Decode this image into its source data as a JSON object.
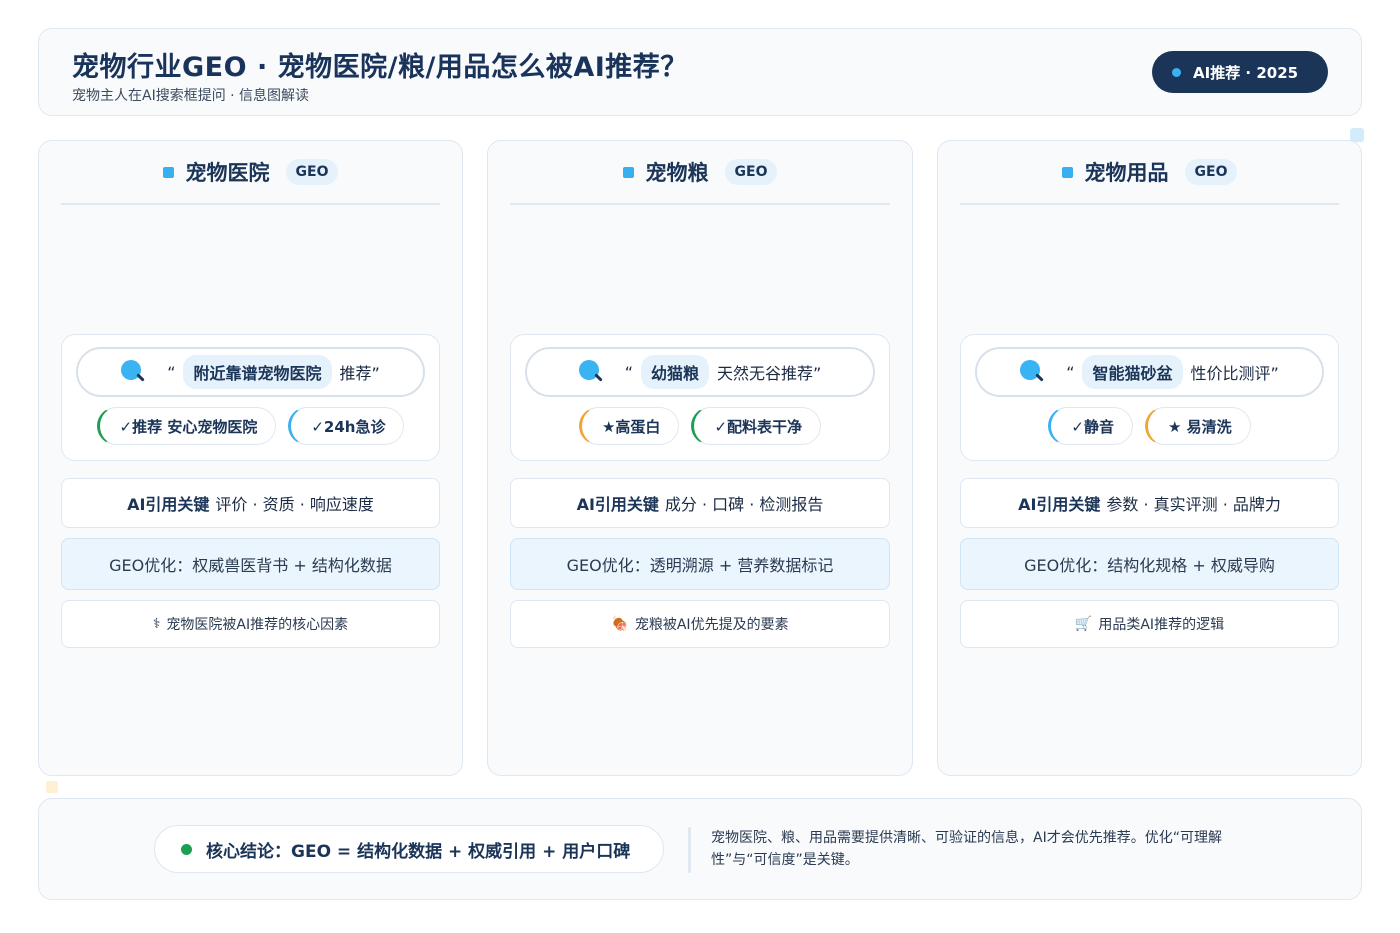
{
  "header": {
    "title": "宠物行业GEO · 宠物医院/粮/用品怎么被AI推荐？",
    "subtitle": "宠物主人在AI搜索框提问 · 信息图解读",
    "badge": "AI推荐 · 2025"
  },
  "columns": [
    {
      "title": "宠物医院",
      "pill": "GEO",
      "search": {
        "open_quote": "“",
        "keyword": "附近靠谱宠物医院",
        "rest": "推荐”"
      },
      "tags": [
        {
          "label": "✓推荐 安心宠物医院",
          "accent": "green"
        },
        {
          "label": "✓24h急诊",
          "accent": "blue"
        }
      ],
      "key_label": "AI引用关键",
      "key_items": "评价 · 资质 · 响应速度",
      "optimization": "GEO优化：权威兽医背书 + 结构化数据",
      "footer_icon": "⚕",
      "footer_icon_name": "caduceus-icon",
      "footer": "宠物医院被AI推荐的核心因素"
    },
    {
      "title": "宠物粮",
      "pill": "GEO",
      "search": {
        "open_quote": "“",
        "keyword": "幼猫粮",
        "rest": "天然无谷推荐”"
      },
      "tags": [
        {
          "label": "★高蛋白",
          "accent": "orange"
        },
        {
          "label": "✓配料表干净",
          "accent": "green"
        }
      ],
      "key_label": "AI引用关键",
      "key_items": "成分 · 口碑 · 检测报告",
      "optimization": "GEO优化：透明溯源 + 营养数据标记",
      "footer_icon": "🍖",
      "footer_icon_name": "meat-icon",
      "footer": "宠粮被AI优先提及的要素"
    },
    {
      "title": "宠物用品",
      "pill": "GEO",
      "search": {
        "open_quote": "“",
        "keyword": "智能猫砂盆",
        "rest": "性价比测评”"
      },
      "tags": [
        {
          "label": "✓静音",
          "accent": "blue"
        },
        {
          "label": "★ 易清洗",
          "accent": "orange"
        }
      ],
      "key_label": "AI引用关键",
      "key_items": "参数 · 真实评测 · 品牌力",
      "optimization": "GEO优化：结构化规格 + 权威导购",
      "footer_icon": "🛒",
      "footer_icon_name": "shopping-cart-icon",
      "footer": "用品类AI推荐的逻辑"
    }
  ],
  "conclusion": {
    "headline": "核心结论：GEO = 结构化数据 + 权威引用 + 用户口碑",
    "description": "宠物医院、粮、用品需要提供清晰、可验证的信息，AI才会优先推荐。优化“可理解性”与“可信度”是关键。"
  },
  "colors": {
    "navy": "#1b3558",
    "accent_blue": "#39b3f2",
    "green": "#1e9e53",
    "orange": "#f0a43a",
    "light_blue_bg": "#eaf5fd"
  }
}
